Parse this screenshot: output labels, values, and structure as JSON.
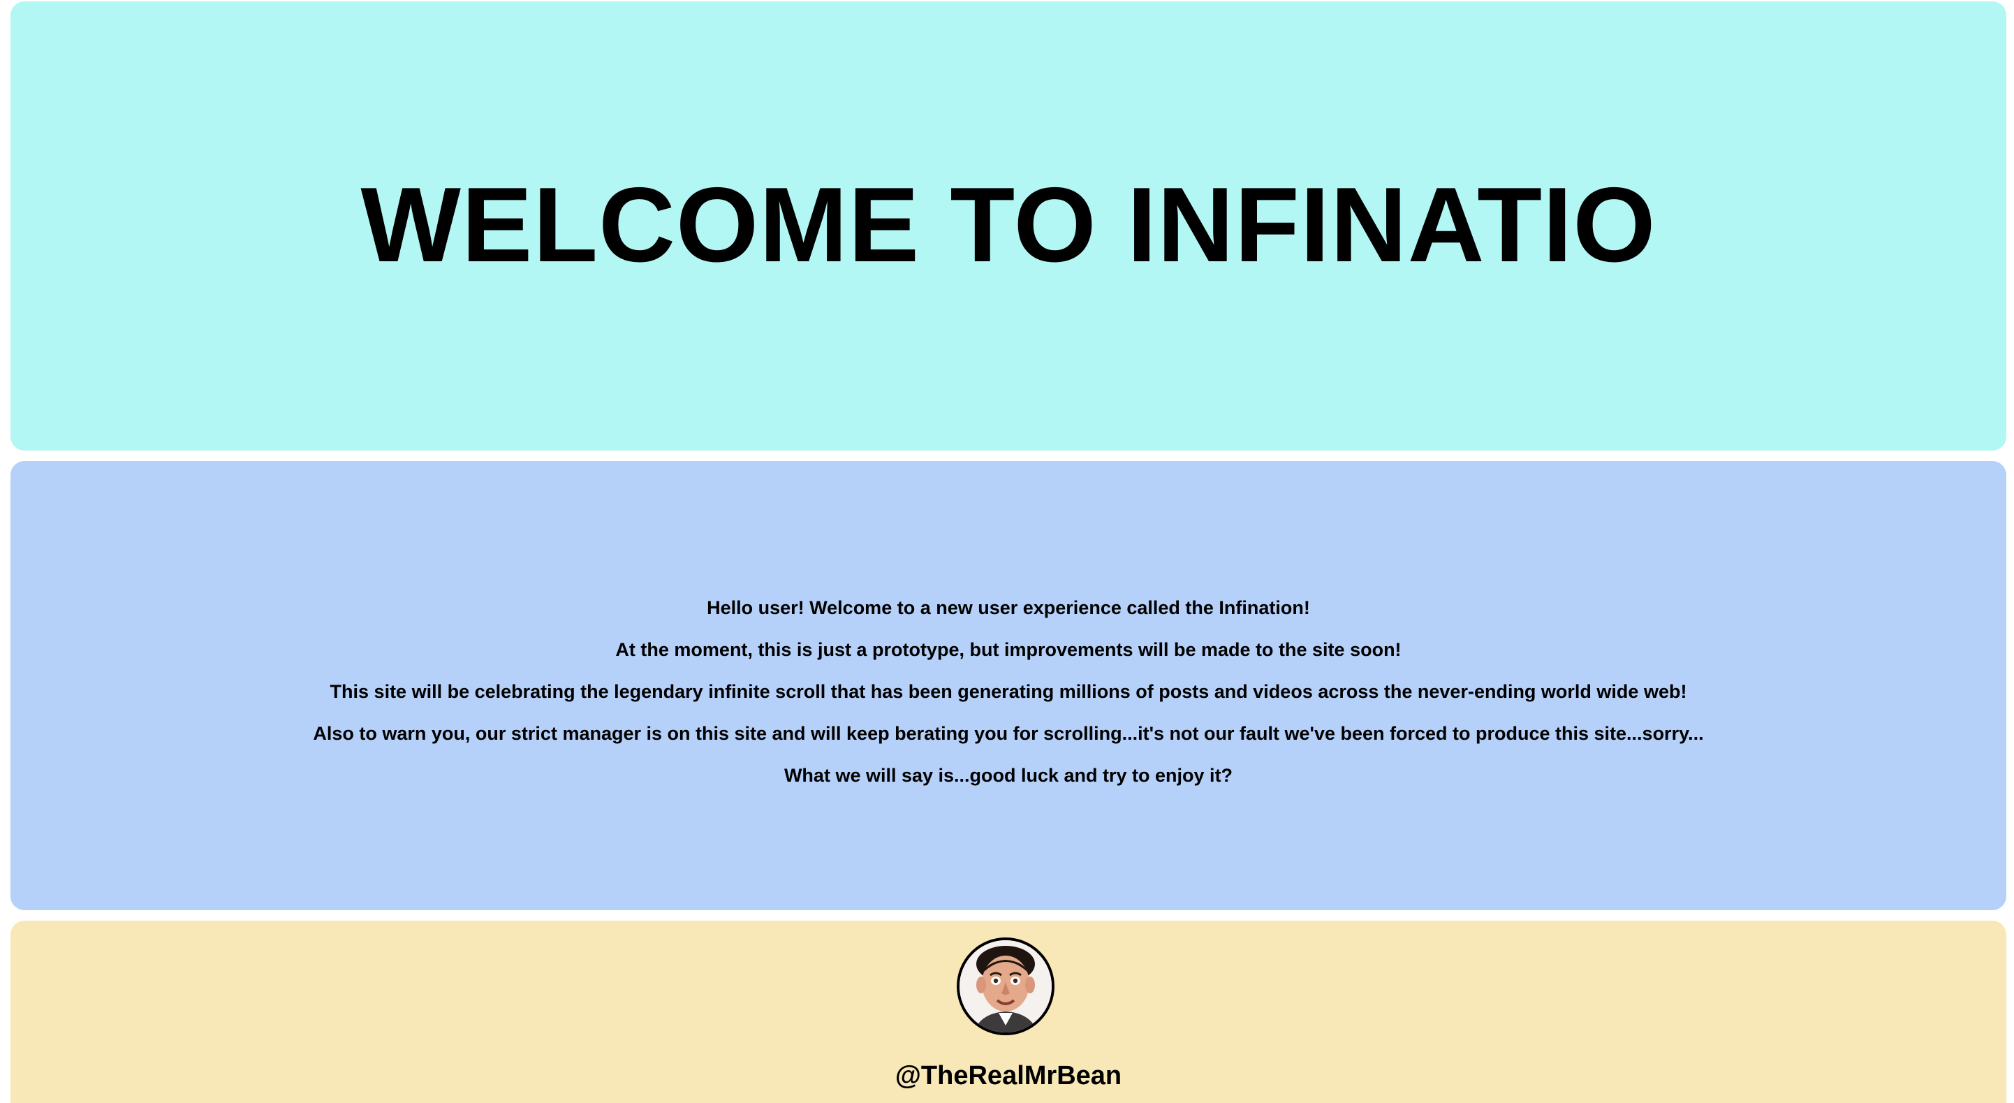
{
  "hero": {
    "title": "WELCOME TO INFINATIO",
    "background": "#b3f7f5"
  },
  "intro": {
    "background": "#b5d0f9",
    "lines": [
      "Hello user! Welcome to a new user experience called the Infination!",
      "At the moment, this is just a prototype, but improvements will be made to the site soon!",
      "This site will be celebrating the legendary infinite scroll that has been generating millions of posts and videos across the never-ending world wide web!",
      "Also to warn you, our strict manager is on this site and will keep berating you for scrolling...it's not our fault we've been forced to produce this site...sorry...",
      "What we will say is...good luck and try to enjoy it?"
    ]
  },
  "post": {
    "background": "#f9e8b7",
    "avatar_icon": "profile-photo",
    "username": "@TheRealMrBean"
  }
}
